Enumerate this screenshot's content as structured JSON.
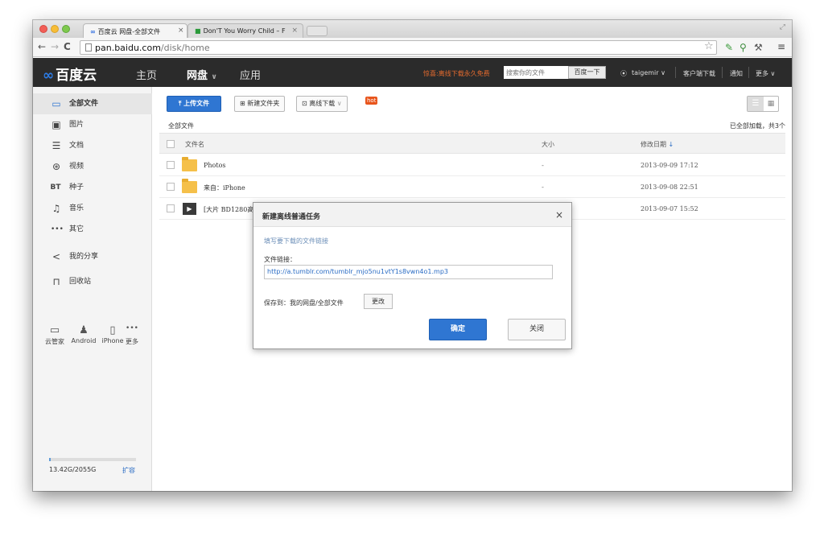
{
  "browser": {
    "tabs": [
      {
        "label": "百度云 网盘-全部文件",
        "close": "×"
      },
      {
        "label": "Don'T You Worry Child – F",
        "close": "×"
      }
    ],
    "url_host": "pan.baidu.com",
    "url_path": "/disk/home"
  },
  "header": {
    "logo": "百度云",
    "nav": [
      {
        "label": "主页"
      },
      {
        "label": "网盘"
      },
      {
        "label": "应用"
      }
    ],
    "promo": "惊喜:离线下载永久免费",
    "search_placeholder": "搜索你的文件",
    "search_button": "百度一下",
    "user": "taigemir",
    "client_download": "客户端下载",
    "notify": "通知",
    "more": "更多"
  },
  "sidebar": {
    "items": [
      {
        "icon": "document-icon",
        "label": "全部文件"
      },
      {
        "icon": "image-icon",
        "label": "图片"
      },
      {
        "icon": "text-icon",
        "label": "文档"
      },
      {
        "icon": "video-icon",
        "label": "视频"
      },
      {
        "icon": "bt-icon",
        "label": "种子",
        "glyph": "BT"
      },
      {
        "icon": "music-icon",
        "label": "音乐"
      },
      {
        "icon": "more-icon",
        "label": "其它"
      },
      {
        "icon": "share-icon",
        "label": "我的分享"
      },
      {
        "icon": "trash-icon",
        "label": "回收站"
      }
    ],
    "devices": [
      {
        "label": "云管家"
      },
      {
        "label": "Android"
      },
      {
        "label": "iPhone"
      },
      {
        "label": "更多"
      }
    ],
    "quota_text": "13.42G/2055G",
    "quota_fraction": 0.0065,
    "quota_link": "扩容"
  },
  "toolbar": {
    "upload": "上传文件",
    "new_folder": "新建文件夹",
    "offline_download": "离线下载",
    "hot": "hot"
  },
  "breadcrumb": "全部文件",
  "loaded_status": "已全部加载，共3个",
  "table": {
    "headers": {
      "name": "文件名",
      "size": "大小",
      "date": "修改日期"
    },
    "rows": [
      {
        "name": "Photos",
        "size": "-",
        "date": "2013-09-09 17:12",
        "type": "folder"
      },
      {
        "name": "来自：iPhone",
        "size": "-",
        "date": "2013-09-08 22:51",
        "type": "folder"
      },
      {
        "name": "[大片 BD1280高清",
        "size": "",
        "date": "2013-09-07 15:52",
        "type": "video"
      }
    ]
  },
  "dialog": {
    "title": "新建离线普通任务",
    "close": "×",
    "hint": "填写要下载的文件链接",
    "link_label": "文件链接：",
    "link_value": "http://a.tumblr.com/tumblr_mjo5nu1vtY1s8vwn4o1.mp3",
    "save_to": "保存到：我的网盘/全部文件",
    "change": "更改",
    "ok": "确定",
    "cancel": "关闭"
  },
  "colors": {
    "accent": "#2f76d2",
    "header_bg": "#2b2b2b",
    "promo": "#e36a2e",
    "hot": "#e8551c"
  }
}
